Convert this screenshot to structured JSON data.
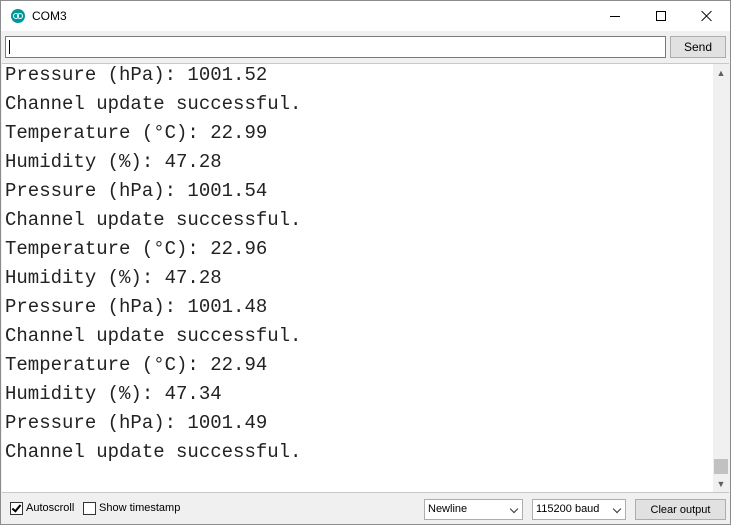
{
  "window": {
    "title": "COM3"
  },
  "input": {
    "value": "",
    "send_label": "Send"
  },
  "output": {
    "lines": [
      "Pressure (hPa): 1001.52",
      "Channel update successful.",
      "Temperature (°C): 22.99",
      "Humidity (%): 47.28",
      "Pressure (hPa): 1001.54",
      "Channel update successful.",
      "Temperature (°C): 22.96",
      "Humidity (%): 47.28",
      "Pressure (hPa): 1001.48",
      "Channel update successful.",
      "Temperature (°C): 22.94",
      "Humidity (%): 47.34",
      "Pressure (hPa): 1001.49",
      "Channel update successful."
    ]
  },
  "footer": {
    "autoscroll_label": "Autoscroll",
    "autoscroll_checked": true,
    "timestamp_label": "Show timestamp",
    "timestamp_checked": false,
    "line_ending": "Newline",
    "baud_rate": "115200 baud",
    "clear_label": "Clear output"
  },
  "icons": {
    "app": "arduino-icon",
    "minimize": "minimize-icon",
    "maximize": "maximize-icon",
    "close": "close-icon"
  }
}
